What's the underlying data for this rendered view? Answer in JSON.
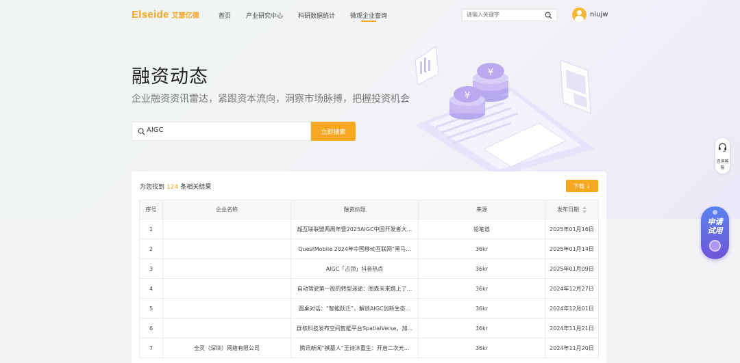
{
  "header": {
    "logo_en": "Elseide",
    "logo_cn": "艾瑟亿德",
    "nav": [
      {
        "label": "首页"
      },
      {
        "label": "产业研究中心"
      },
      {
        "label": "科研数据统计"
      },
      {
        "label": "微观企业查询"
      }
    ],
    "search_placeholder": "请输入关键字",
    "username": "niujw"
  },
  "hero": {
    "title": "融资动态",
    "subtitle": "企业融资资讯雷达，紧跟资本流向，洞察市场脉搏，把握投资机会",
    "search_value": "AIGC",
    "search_button": "立即搜索"
  },
  "results": {
    "prefix": "为您找到",
    "count": "124",
    "suffix": "条相关结果",
    "download_label": "下载 ⇣",
    "columns": [
      "序号",
      "企业名称",
      "融资标题",
      "来源",
      "发布日期"
    ],
    "rows": [
      {
        "index": "1",
        "company": "",
        "title": "超互联联盟两周年暨2025AIGC中国开发者大...",
        "source": "铅笔道",
        "date": "2025年01月16日"
      },
      {
        "index": "2",
        "company": "",
        "title": "QuestMobile 2024年中国移动互联网“黑马...",
        "source": "36kr",
        "date": "2025年01月14日"
      },
      {
        "index": "3",
        "company": "",
        "title": "AIGC「占领」抖音热点",
        "source": "36kr",
        "date": "2025年01月09日"
      },
      {
        "index": "4",
        "company": "",
        "title": "自动驾驶第一股的转型迷途：图森未来踏上了...",
        "source": "36kr",
        "date": "2024年12月27日"
      },
      {
        "index": "5",
        "company": "",
        "title": "圆桌对话：“智能跃迁”，解锁AIGC创新生态...",
        "source": "36kr",
        "date": "2024年12月01日"
      },
      {
        "index": "6",
        "company": "",
        "title": "群核科技发布空间智能平台SpatialVerse，加...",
        "source": "36kr",
        "date": "2024年11月21日"
      },
      {
        "index": "7",
        "company": "全灵（深圳）网络有限公司",
        "title": "腾讯新闻“撰墓人”王诗沐重生：开启二次元...",
        "source": "36kr",
        "date": "2024年11月20日"
      }
    ]
  },
  "widgets": {
    "consult_label": "咨询客服",
    "trial_label_1": "申请",
    "trial_label_2": "试用"
  },
  "colors": {
    "accent": "#f7a823",
    "trial": "#6f54d6"
  }
}
